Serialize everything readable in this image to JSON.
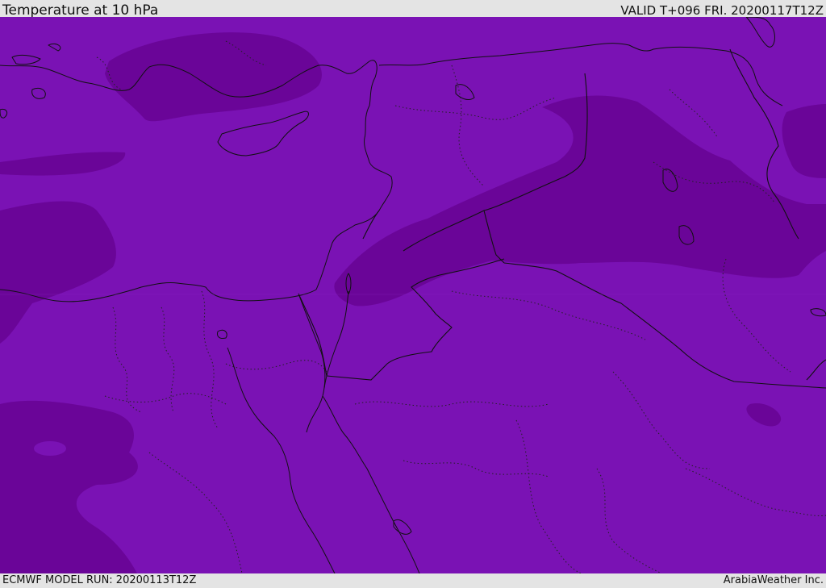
{
  "header": {
    "title": "Temperature at 10 hPa",
    "valid": "VALID T+096 FRI. 20200117T12Z"
  },
  "footer": {
    "model_run": "ECMWF MODEL RUN: 20200113T12Z",
    "brand": "ArabiaWeather Inc."
  },
  "map": {
    "colors": {
      "base_fill": "#7a12b4",
      "dark_fill": "#6a0598",
      "line": "#111111"
    }
  }
}
